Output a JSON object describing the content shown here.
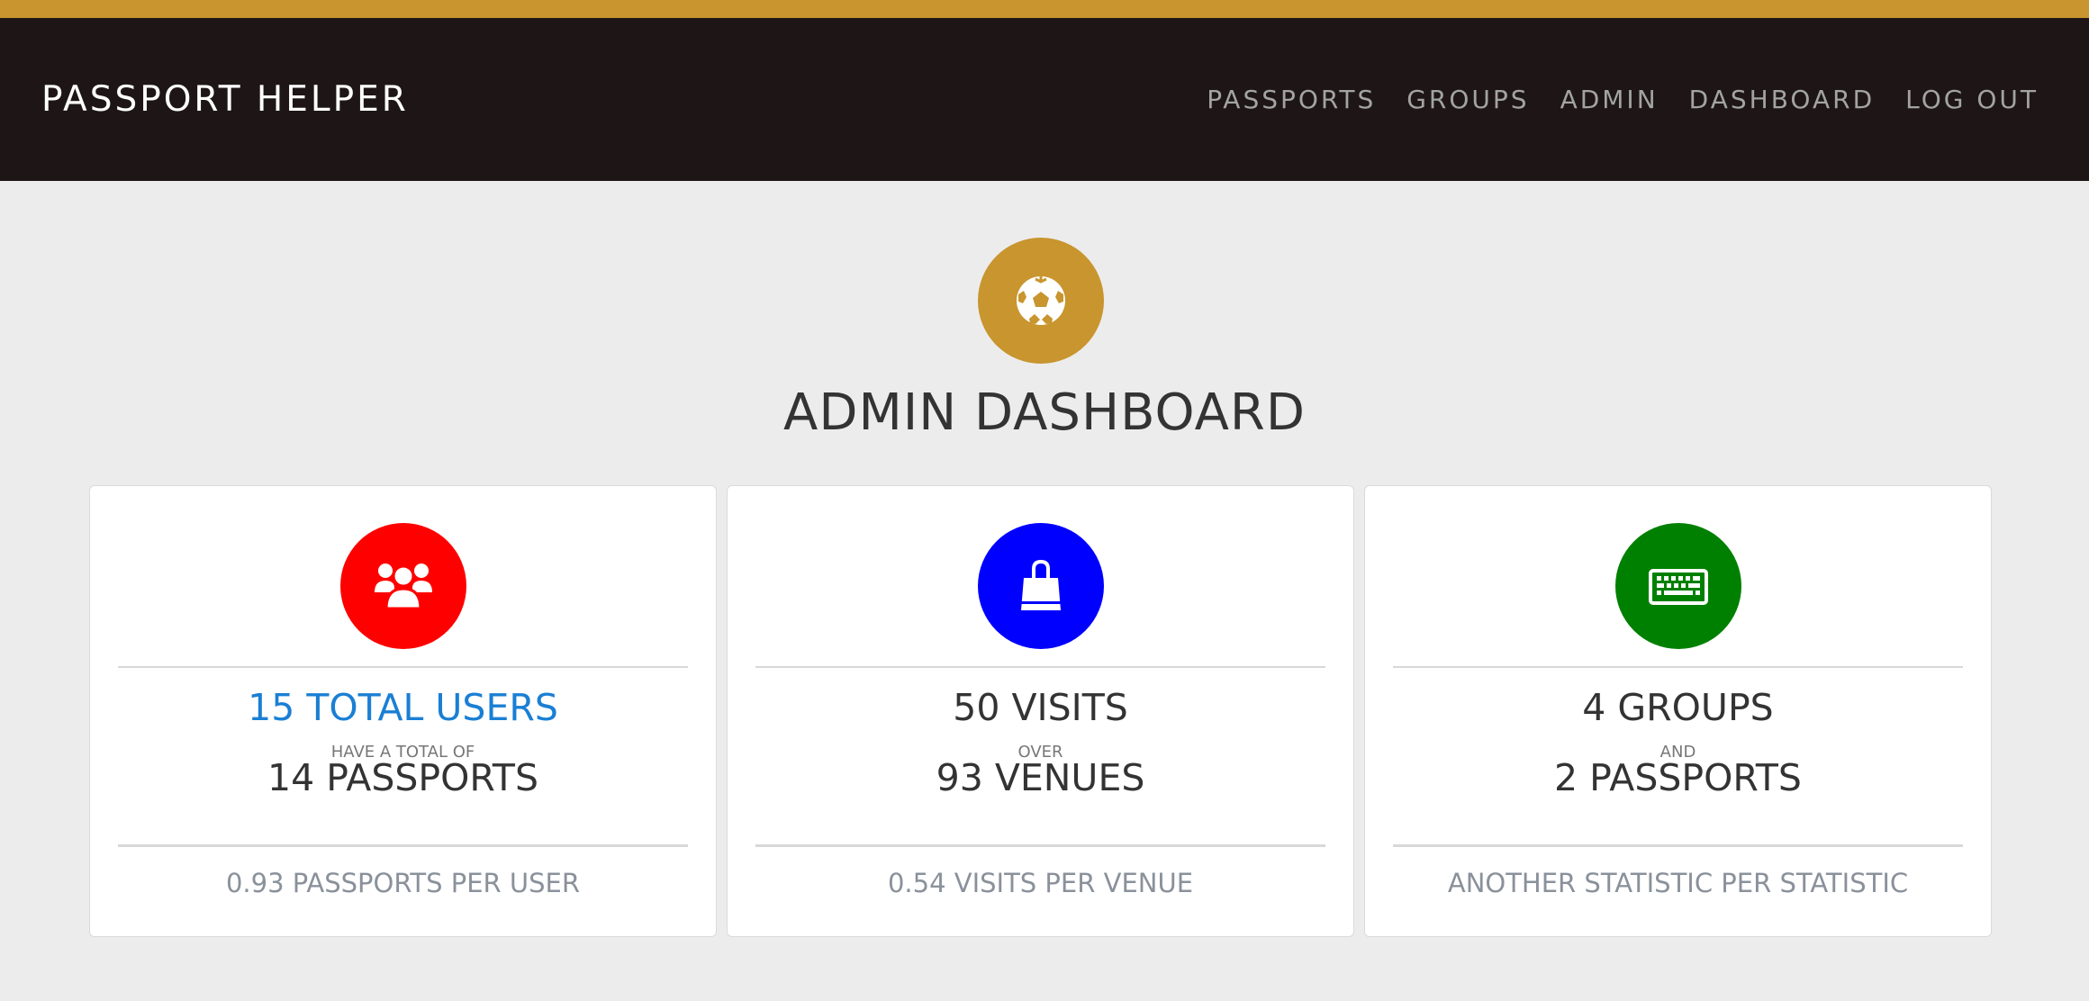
{
  "header": {
    "brand": "PASSPORT HELPER",
    "nav": [
      {
        "label": "PASSPORTS"
      },
      {
        "label": "GROUPS"
      },
      {
        "label": "ADMIN"
      },
      {
        "label": "DASHBOARD"
      },
      {
        "label": "LOG OUT"
      }
    ]
  },
  "hero": {
    "icon": "soccer-ball-icon",
    "title": "ADMIN DASHBOARD"
  },
  "cards": [
    {
      "icon": "users-icon",
      "icon_color": "#ff0000",
      "main": "15 TOTAL USERS",
      "connector": "HAVE A TOTAL OF",
      "second": "14 PASSPORTS",
      "footer": "0.93 PASSPORTS PER USER"
    },
    {
      "icon": "shopping-bag-icon",
      "icon_color": "#0000ff",
      "main": "50 VISITS",
      "connector": "OVER",
      "second": "93 VENUES",
      "footer": "0.54 VISITS PER VENUE"
    },
    {
      "icon": "keyboard-icon",
      "icon_color": "#008000",
      "main": "4 GROUPS",
      "connector": "AND",
      "second": "2 PASSPORTS",
      "footer": "ANOTHER STATISTIC PER STATISTIC"
    }
  ],
  "colors": {
    "accent_gold": "#c8952e",
    "navbar_bg": "#1e1616",
    "highlight_blue": "#1a7fd4"
  }
}
